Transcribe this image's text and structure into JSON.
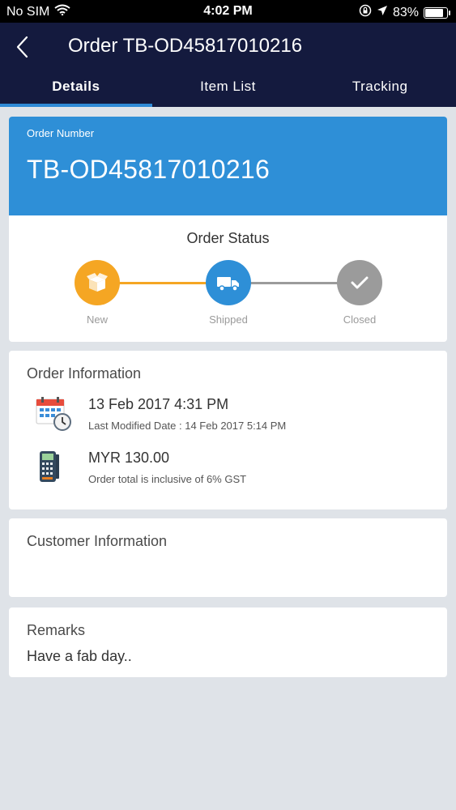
{
  "status_bar": {
    "carrier": "No SIM",
    "time": "4:02 PM",
    "battery": "83%",
    "battery_level": 0.83
  },
  "header": {
    "title": "Order TB-OD45817010216"
  },
  "tabs": [
    {
      "label": "Details",
      "active": true
    },
    {
      "label": "Item List",
      "active": false
    },
    {
      "label": "Tracking",
      "active": false
    }
  ],
  "order": {
    "number_label": "Order Number",
    "number": "TB-OD45817010216"
  },
  "order_status": {
    "title": "Order Status",
    "steps": [
      {
        "label": "New",
        "icon": "package-icon",
        "color": "#f5a623"
      },
      {
        "label": "Shipped",
        "icon": "truck-icon",
        "color": "#2e8fd7"
      },
      {
        "label": "Closed",
        "icon": "check-icon",
        "color": "#9b9b9b"
      }
    ]
  },
  "order_info": {
    "title": "Order Information",
    "date": "13 Feb 2017 4:31 PM",
    "last_modified": "Last Modified Date :  14 Feb 2017 5:14 PM",
    "amount": "MYR 130.00",
    "amount_note": "Order total is inclusive of 6% GST"
  },
  "customer_info": {
    "title": "Customer Information"
  },
  "remarks": {
    "title": "Remarks",
    "text": "Have a fab day.."
  },
  "colors": {
    "nav_bg": "#141a3e",
    "accent": "#2e8fd7",
    "new": "#f5a623",
    "closed": "#9b9b9b"
  }
}
